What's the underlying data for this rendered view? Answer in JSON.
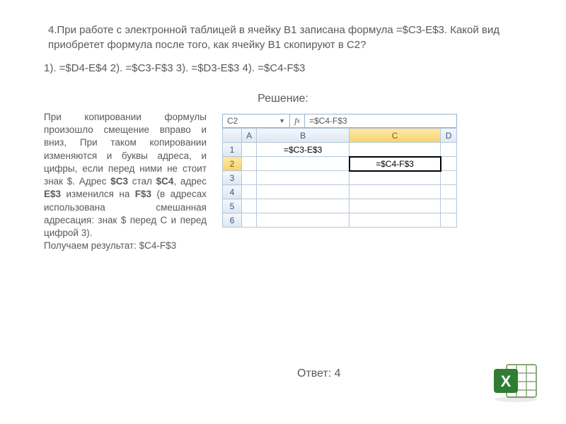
{
  "question": "4.При работе с электронной таблицей в ячейку B1 записана формула =$C3-E$3. Какой вид приобретет формула после того, как  ячейку B1 скопируют в C2?",
  "options": "1). =$D4-E$4   2). =$C3-F$3   3). =$D3-E$3   4). =$C4-F$3",
  "solution_label": "Решение:",
  "explanation_parts": {
    "p1": "При копировании формулы произошло смещение вправо и вниз, При таком копировании изменяются и буквы адреса, и цифры, если перед ними не стоит знак $. Адрес ",
    "b1": "$C3",
    "p2": " стал ",
    "b2": "$C4",
    "p3": ", адрес ",
    "b3": "E$3",
    "p4": " изменился на ",
    "b4": "F$3",
    "p5": "   (в адресах использована смешанная адресация: знак $ перед C и перед цифрой 3).",
    "p6": "Получаем результат: $C4-F$3"
  },
  "sheet": {
    "active_cell": "C2",
    "formula": "=$C4-F$3",
    "cols": [
      "A",
      "B",
      "C",
      "D"
    ],
    "rows": [
      "1",
      "2",
      "3",
      "4",
      "5",
      "6"
    ],
    "b1": "=$С3-E$3",
    "c2": "=$C4-F$3"
  },
  "answer": "Ответ: 4"
}
